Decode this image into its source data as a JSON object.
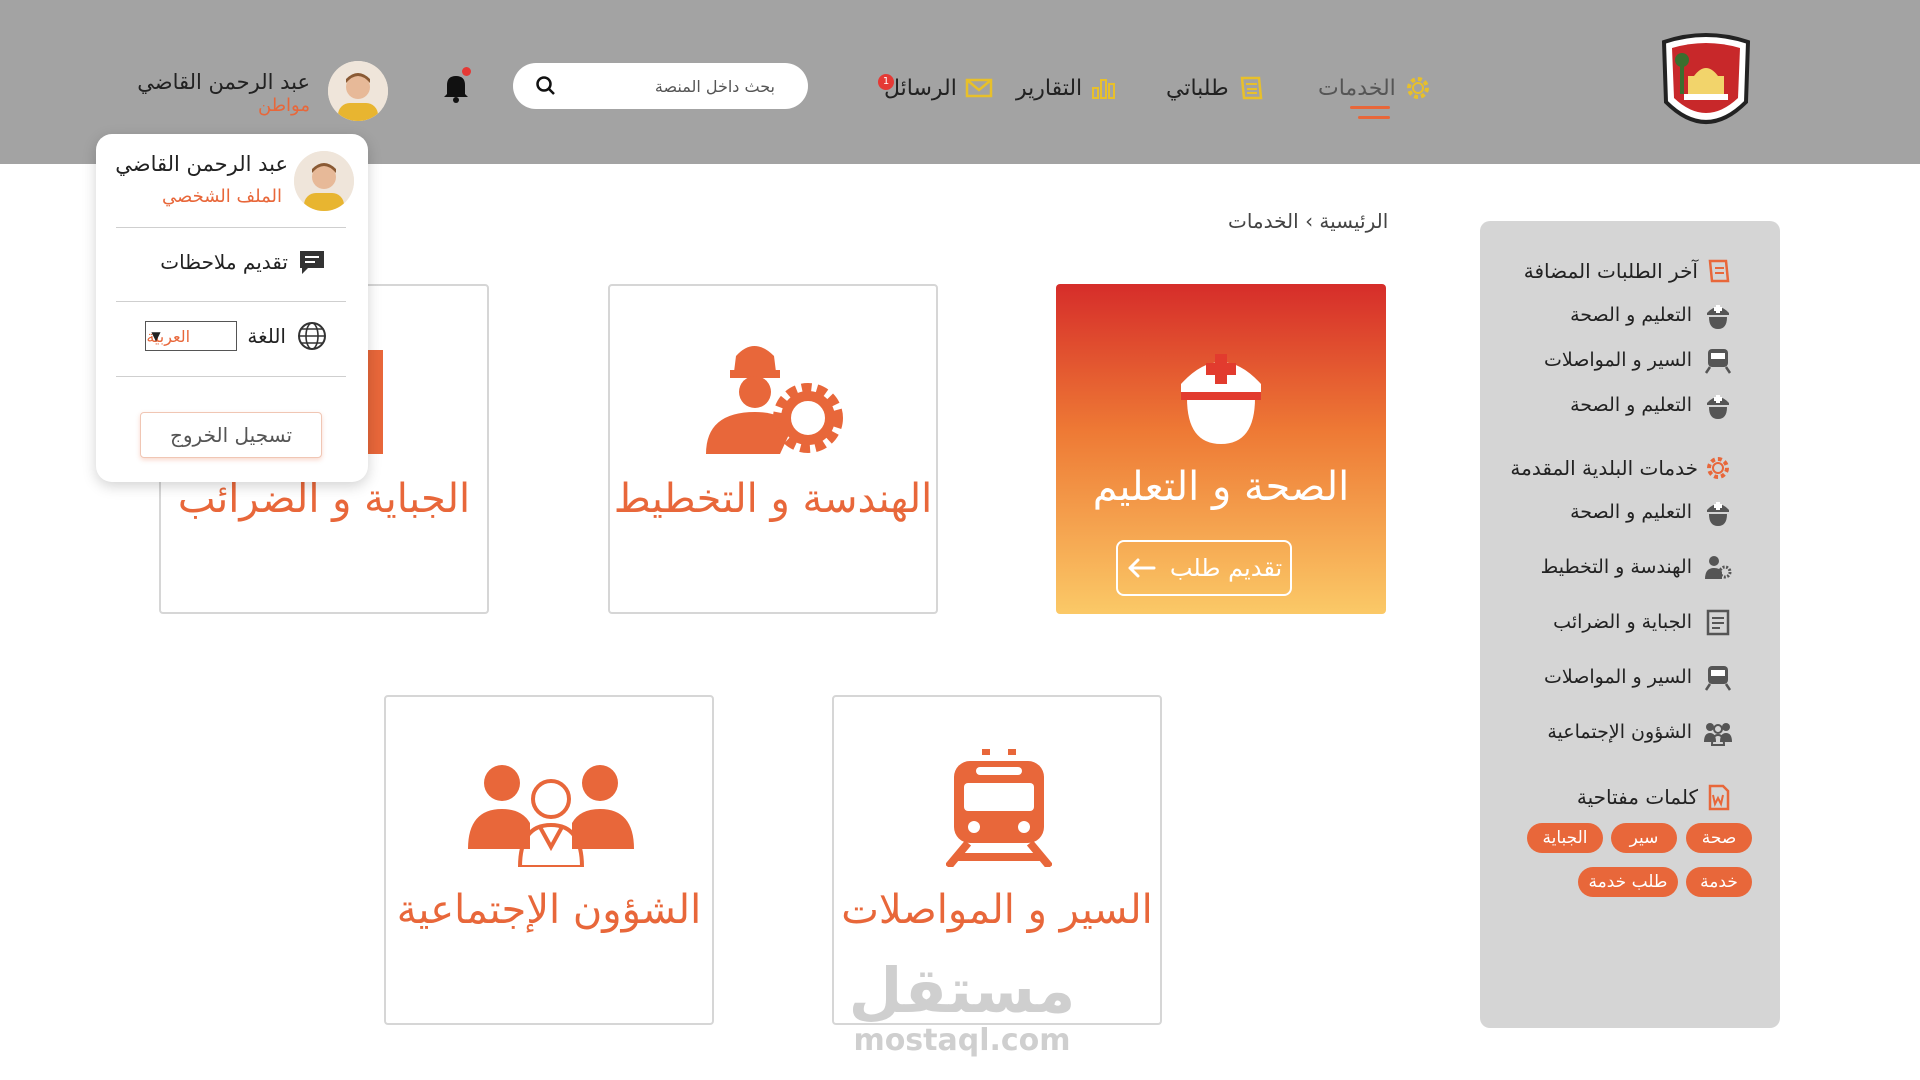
{
  "header": {
    "nav": {
      "services": "الخدمات",
      "my_requests": "طلباتي",
      "reports": "التقارير",
      "messages": "الرسائل",
      "messages_count": "1"
    },
    "search": {
      "placeholder": "بحث داخل المنصة"
    },
    "user": {
      "name": "عبد الرحمن القاضي",
      "role": "مواطن"
    }
  },
  "dropdown": {
    "name": "عبد الرحمن القاضي",
    "profile": "الملف الشخصي",
    "feedback": "تقديم ملاحظات",
    "language_label": "اللغة",
    "language_value": "العربية",
    "logout": "تسجيل الخروج"
  },
  "breadcrumb": {
    "home": "الرئيسية",
    "sep": "›",
    "current": "الخدمات"
  },
  "cards": {
    "health": "الصحة و التعليم",
    "apply": "تقديم طلب",
    "engineering": "الهندسة و التخطيط",
    "taxes": "الجباية  و الضرائب",
    "transport": "السير  و المواصلات",
    "social": "الشؤون الإجتماعية"
  },
  "sidebar": {
    "recent_title": "آخر الطلبات المضافة",
    "recent_items": [
      "التعليم و الصحة",
      "السير و المواصلات",
      "التعليم و الصحة"
    ],
    "services_title": "خدمات البلدية المقدمة",
    "service_items": [
      "التعليم و الصحة",
      "الهندسة و التخطيط",
      "الجباية  و الضرائب",
      "السير  و المواصلات",
      "الشؤون الإجتماعية"
    ],
    "keywords_title": "كلمات مفتاحية",
    "tags": [
      "صحة",
      "سير",
      "الجباية",
      "خدمة",
      "طلب خدمة"
    ]
  },
  "watermark": {
    "word": "مستقل",
    "domain": "mostaql.com"
  },
  "colors": {
    "accent": "#e8673a",
    "header_bg": "#a3a3a3",
    "sidebar_bg": "#d5d5d5",
    "icon_yellow": "#e8c02a"
  }
}
